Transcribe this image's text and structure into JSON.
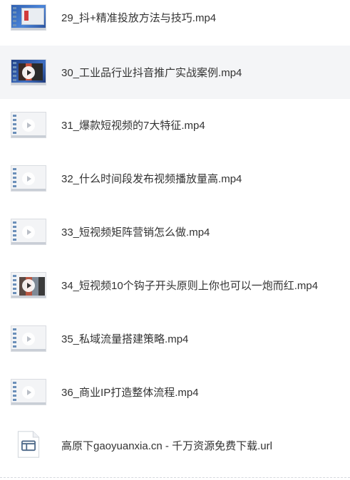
{
  "files": [
    {
      "name": "29_抖+精准投放方法与技巧.mp4",
      "thumb": "blue-desktop-thumbnail",
      "selected": false
    },
    {
      "name": "30_工业品行业抖音推广实战案例.mp4",
      "thumb": "dark-desktop-thumbnail",
      "selected": true
    },
    {
      "name": "31_爆款短视频的7大特征.mp4",
      "thumb": "light-video-thumbnail",
      "selected": false
    },
    {
      "name": "32_什么时间段发布视频播放量高.mp4",
      "thumb": "light-video-thumbnail",
      "selected": false
    },
    {
      "name": "33_短视频矩阵营销怎么做.mp4",
      "thumb": "light-video-thumbnail",
      "selected": false
    },
    {
      "name": "34_短视频10个钩子开头原则上你也可以一炮而红.mp4",
      "thumb": "photo-video-thumbnail",
      "selected": false
    },
    {
      "name": "35_私域流量搭建策略.mp4",
      "thumb": "light-video-thumbnail",
      "selected": false
    },
    {
      "name": "36_商业IP打造整体流程.mp4",
      "thumb": "light-video-thumbnail",
      "selected": false
    },
    {
      "name": "高原下gaoyuanxia.cn - 千万资源免费下载.url",
      "thumb": "url-file-icon",
      "selected": false
    }
  ],
  "colors": {
    "selected_row": "#f4f5f7",
    "text": "#333333",
    "url_icon": "#4f6a8a"
  }
}
